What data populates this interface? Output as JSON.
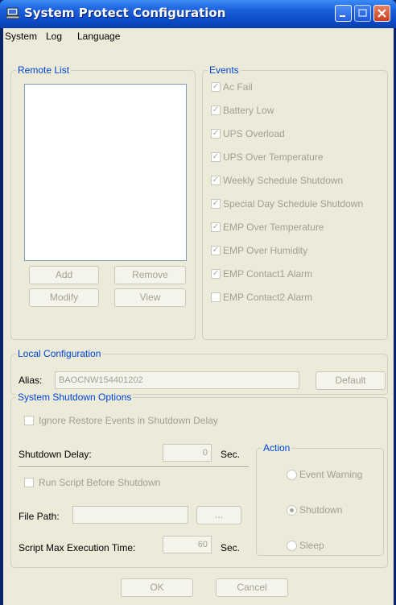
{
  "window": {
    "title": "System Protect Configuration"
  },
  "menu": [
    "System",
    "Log",
    "Language"
  ],
  "remote_list": {
    "legend": "Remote List",
    "buttons": {
      "add": "Add",
      "remove": "Remove",
      "modify": "Modify",
      "view": "View"
    }
  },
  "events": {
    "legend": "Events",
    "items": [
      {
        "label": "Ac Fail",
        "checked": true
      },
      {
        "label": "Battery Low",
        "checked": true
      },
      {
        "label": "UPS Overload",
        "checked": true
      },
      {
        "label": "UPS Over Temperature",
        "checked": true
      },
      {
        "label": "Weekly Schedule Shutdown",
        "checked": true
      },
      {
        "label": "Special Day Schedule Shutdown",
        "checked": true
      },
      {
        "label": "EMP Over Temperature",
        "checked": true
      },
      {
        "label": "EMP Over Humidity",
        "checked": true
      },
      {
        "label": "EMP Contact1 Alarm",
        "checked": true
      },
      {
        "label": "EMP Contact2 Alarm",
        "checked": false
      }
    ]
  },
  "local": {
    "legend": "Local Configuration",
    "alias_label": "Alias:",
    "alias_value": "BAOCNW154401202",
    "default_button": "Default"
  },
  "shutdown": {
    "legend": "System Shutdown Options",
    "ignore_label": "Ignore Restore Events in Shutdown Delay",
    "delay_label": "Shutdown Delay:",
    "delay_value": "0",
    "delay_unit": "Sec.",
    "run_script_label": "Run Script Before Shutdown",
    "file_path_label": "File Path:",
    "browse_button": "...",
    "max_time_label": "Script Max Execution Time:",
    "max_time_value": "60",
    "max_time_unit": "Sec.",
    "action": {
      "legend": "Action",
      "options": [
        {
          "label": "Event Warning",
          "selected": false
        },
        {
          "label": "Shutdown",
          "selected": true
        },
        {
          "label": "Sleep",
          "selected": false
        }
      ]
    }
  },
  "footer": {
    "ok": "OK",
    "cancel": "Cancel"
  },
  "colors": {
    "title_bar": "#0d4cc9",
    "legend_text": "#0046d5",
    "client_bg": "#ecead8",
    "disabled_text": "#a0a094"
  }
}
